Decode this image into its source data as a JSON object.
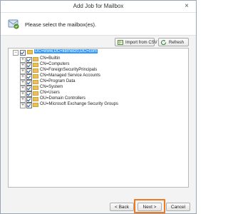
{
  "window": {
    "title": "Add Job for Mailbox",
    "close_glyph": "×"
  },
  "header": {
    "text": "Please select the mailbox(es).",
    "icon": "mailbox-wizard-icon"
  },
  "toolbar": {
    "import_label": "Import from CSV",
    "refresh_label": "Refresh"
  },
  "tree": {
    "root": "DC=www,DC=kernel20,DC=com",
    "children": [
      "CN=Builtin",
      "CN=Computers",
      "CN=ForeignSecurityPrincipals",
      "CN=Managed Service Accounts",
      "CN=Program Data",
      "CN=System",
      "CN=Users",
      "OU=Domain Controllers",
      "OU=Microsoft Exchange Security Groups"
    ]
  },
  "footer": {
    "back_label": "< Back",
    "next_label": "Next >",
    "cancel_label": "Cancel"
  },
  "colors": {
    "selection": "#3399ff",
    "highlight": "#f07a22"
  }
}
